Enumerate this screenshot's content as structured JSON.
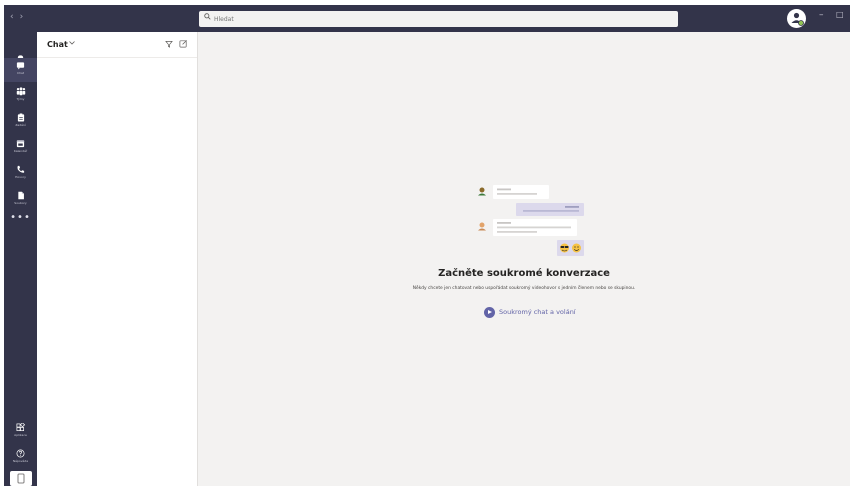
{
  "titlebar": {
    "nav_back": "‹",
    "nav_forward": "›",
    "search_placeholder": "Hledat",
    "minimize": "–",
    "maximize": "□"
  },
  "rail": {
    "items": [
      {
        "label": "Aktivita",
        "icon": "bell-icon"
      },
      {
        "label": "Chat",
        "icon": "chat-icon"
      },
      {
        "label": "Týmy",
        "icon": "teams-icon"
      },
      {
        "label": "Zadání",
        "icon": "assignments-icon"
      },
      {
        "label": "Kalendář",
        "icon": "calendar-icon"
      },
      {
        "label": "Hovory",
        "icon": "phone-icon"
      },
      {
        "label": "Soubory",
        "icon": "file-icon"
      }
    ],
    "more": "•••",
    "bottom": [
      {
        "label": "Aplikace",
        "icon": "apps-icon"
      },
      {
        "label": "Nápověda",
        "icon": "help-icon"
      }
    ]
  },
  "list_pane": {
    "title": "Chat"
  },
  "main": {
    "title": "Začněte soukromé konverzace",
    "subtitle": "Někdy chcete jen chatovat nebo uspořádat soukromý videohovor s jedním členem nebo se skupinou.",
    "start_link": "Soukromý chat a volání"
  },
  "colors": {
    "rail_bg": "#33344a",
    "accent": "#6264a7",
    "main_bg": "#f3f2f1"
  }
}
